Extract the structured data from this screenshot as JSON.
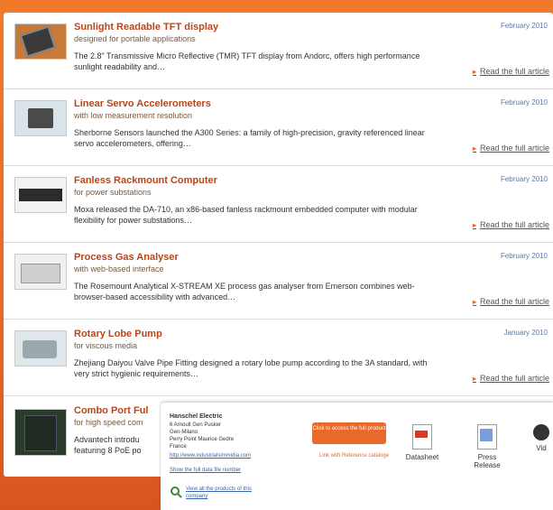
{
  "articles": [
    {
      "title": "Sunlight Readable TFT display",
      "subtitle": "designed for portable applications",
      "excerpt": "The 2.8\" Transmissive Micro Reflective (TMR) TFT display from Andorc, offers high performance sunlight readability and…",
      "date": "February 2010",
      "read_more": "Read the full article",
      "thumb_icon": "tft-display-photo"
    },
    {
      "title": "Linear Servo Accelerometers",
      "subtitle": "with low measurement resolution",
      "excerpt": "Sherborne Sensors launched the A300 Series: a family of high-precision, gravity referenced linear servo accelerometers, offering…",
      "date": "February 2010",
      "read_more": "Read the full article",
      "thumb_icon": "accelerometer-photo"
    },
    {
      "title": "Fanless Rackmount Computer",
      "subtitle": "for power substations",
      "excerpt": "Moxa released the DA-710, an x86-based fanless rackmount embedded computer with modular flexibility for power substations…",
      "date": "February 2010",
      "read_more": "Read the full article",
      "thumb_icon": "rackmount-computer-photo"
    },
    {
      "title": "Process Gas Analyser",
      "subtitle": "with web-based interface",
      "excerpt": "The Rosemount Analytical X-STREAM XE process gas analyser from Emerson combines web-browser-based accessibility with advanced…",
      "date": "February 2010",
      "read_more": "Read the full article",
      "thumb_icon": "gas-analyser-photo"
    },
    {
      "title": "Rotary Lobe Pump",
      "subtitle": "for viscous media",
      "excerpt": "Zhejiang Daiyou Valve Pipe Fitting designed a rotary lobe pump according to the 3A standard, with very strict hygienic requirements…",
      "date": "January 2010",
      "read_more": "Read the full article",
      "thumb_icon": "pump-photo"
    },
    {
      "title": "Combo Port Ful",
      "subtitle": "for high speed com",
      "excerpt": "Advantech introdu featuring 8 PoE po",
      "thumb_icon": "switch-photo"
    }
  ],
  "contact_card": {
    "company": "Hanschel Electric",
    "lines": [
      "6 Arnoult Gen Pusker",
      "Gen-Milano",
      "Perry Point Maurice Gedre",
      "France"
    ],
    "website": "http://www.industrialsimmidia.com",
    "show_more": "Show the full data file number",
    "cta_button": "Click to access the full product",
    "cta_sub": "Link with Reference cataloge",
    "view_all": "View all the products of this company",
    "icons": [
      {
        "label": "Datasheet",
        "icon": "pdf-icon"
      },
      {
        "label": "Press Release",
        "icon": "press-release-icon"
      },
      {
        "label": "Vid",
        "icon": "video-icon"
      }
    ]
  },
  "colors": {
    "background": "#e9692a",
    "title": "#b8461a",
    "date": "#5a78a8",
    "accent": "#e9692a"
  }
}
